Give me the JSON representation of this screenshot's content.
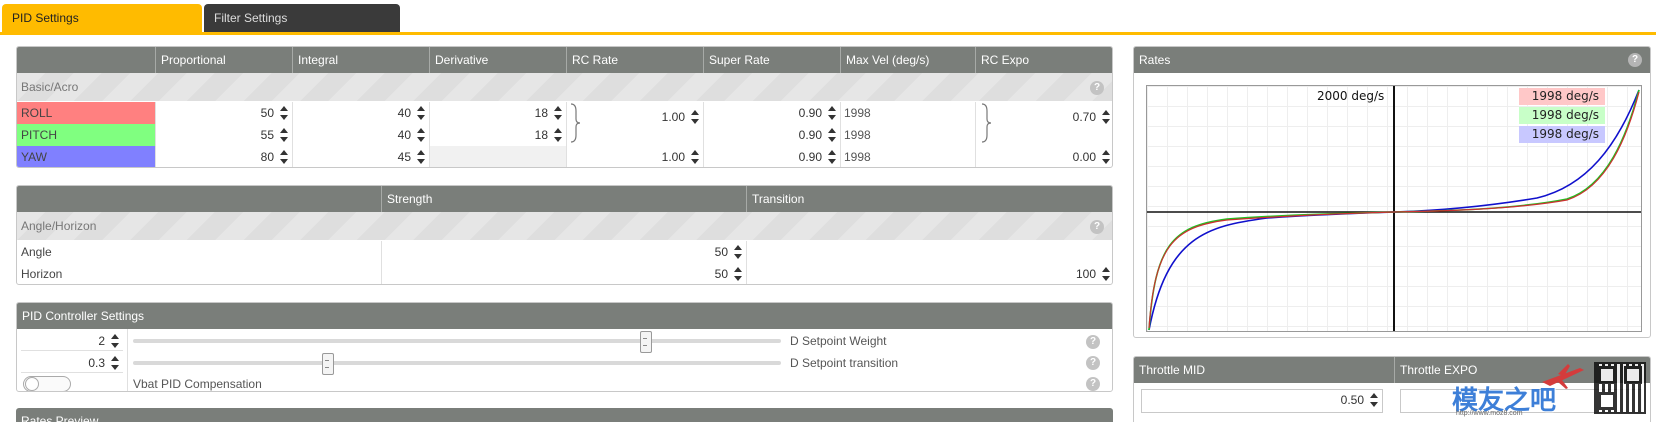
{
  "tabs": [
    {
      "label": "PID Settings",
      "active": true
    },
    {
      "label": "Filter Settings",
      "active": false
    }
  ],
  "pid_table": {
    "columns": [
      "Proportional",
      "Integral",
      "Derivative",
      "RC Rate",
      "Super Rate",
      "Max Vel (deg/s)",
      "RC Expo"
    ],
    "section": "Basic/Acro",
    "rows": [
      {
        "axis": "ROLL",
        "color": "#ff8080",
        "p": "50",
        "i": "40",
        "d": "18",
        "rc_rate": "1.00",
        "super_rate": "0.90",
        "max_vel": "1998",
        "rc_expo": "0.70"
      },
      {
        "axis": "PITCH",
        "color": "#80ff80",
        "p": "55",
        "i": "40",
        "d": "18",
        "rc_rate": "",
        "super_rate": "0.90",
        "max_vel": "1998",
        "rc_expo": ""
      },
      {
        "axis": "YAW",
        "color": "#8080ff",
        "p": "80",
        "i": "45",
        "d": "",
        "rc_rate": "1.00",
        "super_rate": "0.90",
        "max_vel": "1998",
        "rc_expo": "0.00"
      }
    ]
  },
  "angle_table": {
    "columns": [
      "Strength",
      "Transition"
    ],
    "section": "Angle/Horizon",
    "rows": [
      {
        "label": "Angle",
        "strength": "50",
        "transition": ""
      },
      {
        "label": "Horizon",
        "strength": "50",
        "transition": "100"
      }
    ]
  },
  "controller": {
    "title": "PID Controller Settings",
    "setpoint_weight": {
      "value": "2",
      "label": "D Setpoint Weight",
      "slider_fraction": 0.79
    },
    "setpoint_transition": {
      "value": "0.3",
      "label": "D Setpoint transition",
      "slider_fraction": 0.3
    },
    "vbat": {
      "label": "Vbat PID Compensation",
      "enabled": false
    }
  },
  "rates_preview": {
    "title": "Rates Preview"
  },
  "help_glyph": "?",
  "rates_panel": {
    "title": "Rates",
    "max_label": "2000 deg/s",
    "velocities": [
      {
        "text": "1998 deg/s",
        "color": "#ff8080"
      },
      {
        "text": "1998 deg/s",
        "color": "#80ff80"
      },
      {
        "text": "1998 deg/s",
        "color": "#8080ff"
      }
    ]
  },
  "throttle": {
    "mid_label": "Throttle MID",
    "mid_value": "0.50",
    "expo_label": "Throttle EXPO"
  },
  "watermark": {
    "text": "模友之吧",
    "url": "http://www.moz8.com"
  },
  "colors": {
    "accent": "#ffbb00",
    "header": "#7a7e7a"
  }
}
